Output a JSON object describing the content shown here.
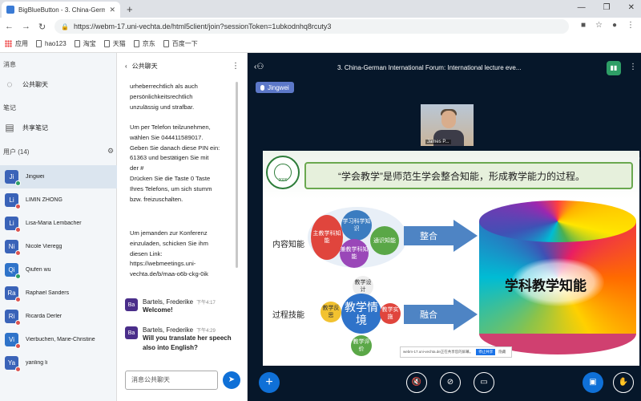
{
  "browser": {
    "tab_title": "BigBlueButton - 3. China-Germ",
    "url": "https://webm-17.uni-vechta.de/html5client/join?sessionToken=1ubkodnhq8rcuty3",
    "bookmarks": [
      "应用",
      "hao123",
      "淘宝",
      "天猫",
      "京东",
      "百度一下"
    ]
  },
  "sidebar": {
    "messages_title": "消息",
    "public_chat": "公共聊天",
    "notes_title": "笔记",
    "shared_notes": "共享笔记",
    "users_title": "用户 (14)"
  },
  "users": [
    {
      "initials": "Ji",
      "name": "Jingwei",
      "color": "#3a63b8",
      "mic": "green"
    },
    {
      "initials": "Li",
      "name": "LIMIN ZHONG",
      "color": "#3a63b8",
      "mic": "red"
    },
    {
      "initials": "Li",
      "name": "Lisa-Maria Lembacher",
      "color": "#3a63b8",
      "mic": "red"
    },
    {
      "initials": "Ni",
      "name": "Nicole Vieregg",
      "color": "#3a63b8",
      "mic": "red"
    },
    {
      "initials": "Qi",
      "name": "Qiufen wu",
      "color": "#2f73c9",
      "mic": "green"
    },
    {
      "initials": "Ra",
      "name": "Raphael Sanders",
      "color": "#3a63b8",
      "mic": "red"
    },
    {
      "initials": "Ri",
      "name": "Ricarda Derler",
      "color": "#3a63b8",
      "mic": "red"
    },
    {
      "initials": "Vi",
      "name": "Vierbuchen, Marie-Christine",
      "color": "#2f73c9",
      "mic": "red"
    },
    {
      "initials": "Ya",
      "name": "yanling li",
      "color": "#3a63b8",
      "mic": "red"
    }
  ],
  "chat": {
    "header": "公共聊天",
    "welcome_lines": [
      "urheberrechtlich als auch",
      "persönlichkeitsrechtlich",
      "unzulässig und strafbar."
    ],
    "phone_lines": [
      "Um per Telefon teilzunehmen,",
      "wählen Sie 044411589017.",
      "Geben Sie danach diese PIN ein:",
      "61363 und bestätigen Sie mit",
      "der #",
      "Drücken Sie die Taste 0 Taste",
      "Ihres Telefons, um sich stumm",
      "bzw. freizuschalten."
    ],
    "invite_lines": [
      "Um jemanden zur Konferenz",
      "einzuladen, schicken Sie ihm",
      "diesen Link:",
      "https://webmeetings.uni-",
      "vechta.de/b/maa-o6b-ckg-0ik"
    ],
    "messages": [
      {
        "initials": "Ba",
        "author": "Bartels, Frederike",
        "time": "下午4:17",
        "text": "Welcome!"
      },
      {
        "initials": "Ba",
        "author": "Bartels, Frederike",
        "time": "下午4:29",
        "text": "Will you translate her speech also into English?"
      }
    ],
    "input_placeholder": "消息公共聊天"
  },
  "presentation": {
    "title": "3. China-German International Forum: International lecture eve...",
    "talking": "Jingwei",
    "webcam_label": "James P...",
    "slide": {
      "seal_year": "2000",
      "slogan": "“学会教学”是师范生学会整合知能，形成教学能力的过程。",
      "row1_label": "内容知能",
      "row2_label": "过程技能",
      "bubbles_top": [
        "主教学科知能",
        "学习科学知识",
        "通识知能",
        "兼教学科知能"
      ],
      "arrow1": "整合",
      "bubbles_bottom": [
        "教学设计",
        "教学反思",
        "教学情境",
        "教学实施",
        "教学评价"
      ],
      "arrow2": "融合",
      "cylinder_label": "学科教学知能",
      "share_notice": "webm-17.uni-vechta.de正在共享您的屏幕。",
      "share_stop": "停止共享",
      "share_hide": "隐藏"
    }
  },
  "colors": {
    "accent": "#0f70d7",
    "presentation_bg": "#06172a",
    "mic_muted": "#d9534f",
    "mic_on": "#2e9e66"
  }
}
